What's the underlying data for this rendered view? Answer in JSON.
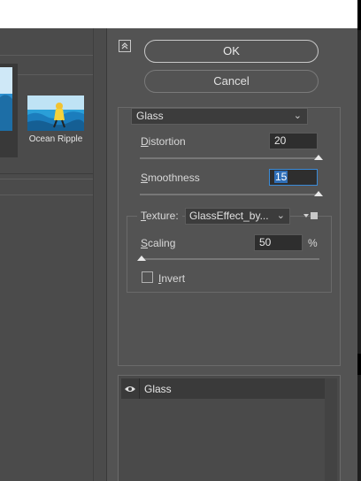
{
  "dialog": {
    "ok_label": "OK",
    "cancel_label": "Cancel"
  },
  "gallery": {
    "thumbnails": [
      {
        "label": "Ocean Ripple",
        "selected": false
      }
    ]
  },
  "filter": {
    "selected": "Glass",
    "distortion": {
      "label_accel": "D",
      "label_rest": "istortion",
      "value": "20",
      "slider_fraction": 1.0
    },
    "smoothness": {
      "label_accel": "S",
      "label_rest": "moothness",
      "value": "15",
      "slider_fraction": 1.0
    },
    "texture": {
      "label_accel": "T",
      "label_rest": "exture:",
      "selected": "GlassEffect_by..."
    },
    "scaling": {
      "label_accel": "S",
      "label_rest": "caling",
      "value": "50",
      "unit": "%",
      "slider_fraction": 0.0
    },
    "invert": {
      "label_accel": "I",
      "label_rest": "nvert",
      "checked": false
    }
  },
  "effect_layers": [
    {
      "name": "Glass",
      "visible": true
    }
  ],
  "colors": {
    "panel_bg": "#535353",
    "field_focus": "#3a8bd8"
  }
}
